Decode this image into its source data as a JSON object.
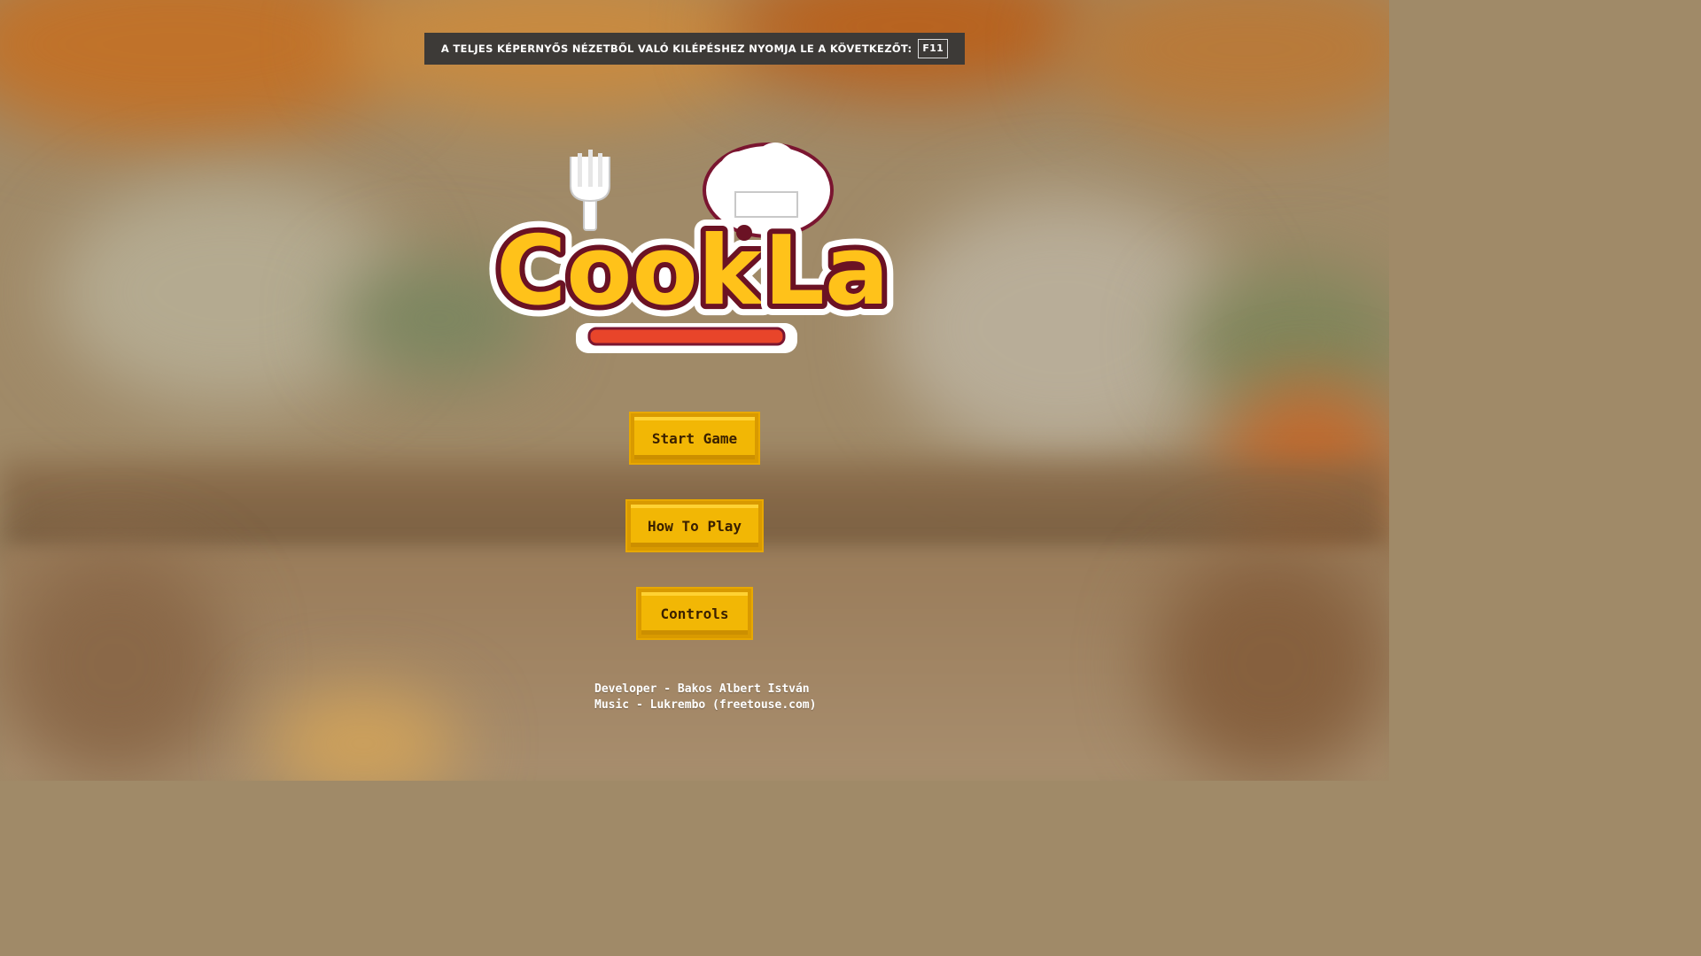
{
  "fullscreen_notice": {
    "text": "A TELJES KÉPERNYŐS NÉZETBŐL VALÓ KILÉPÉSHEZ NYOMJA LE A KÖVETKEZŐT:",
    "key": "F11"
  },
  "logo": {
    "text_main": "Cook",
    "text_second": "La"
  },
  "menu": {
    "start": "Start Game",
    "how_to_play": "How To Play",
    "controls": "Controls"
  },
  "credits": {
    "developer": "Developer - Bakos Albert István",
    "music": "Music - Lukrembo (freetouse.com)"
  },
  "colors": {
    "button_fill": "#f2b705",
    "button_border": "#d99a00",
    "logo_yellow": "#ffc21a",
    "logo_outline": "#6b1224",
    "banner_bg": "#3d3a37"
  }
}
